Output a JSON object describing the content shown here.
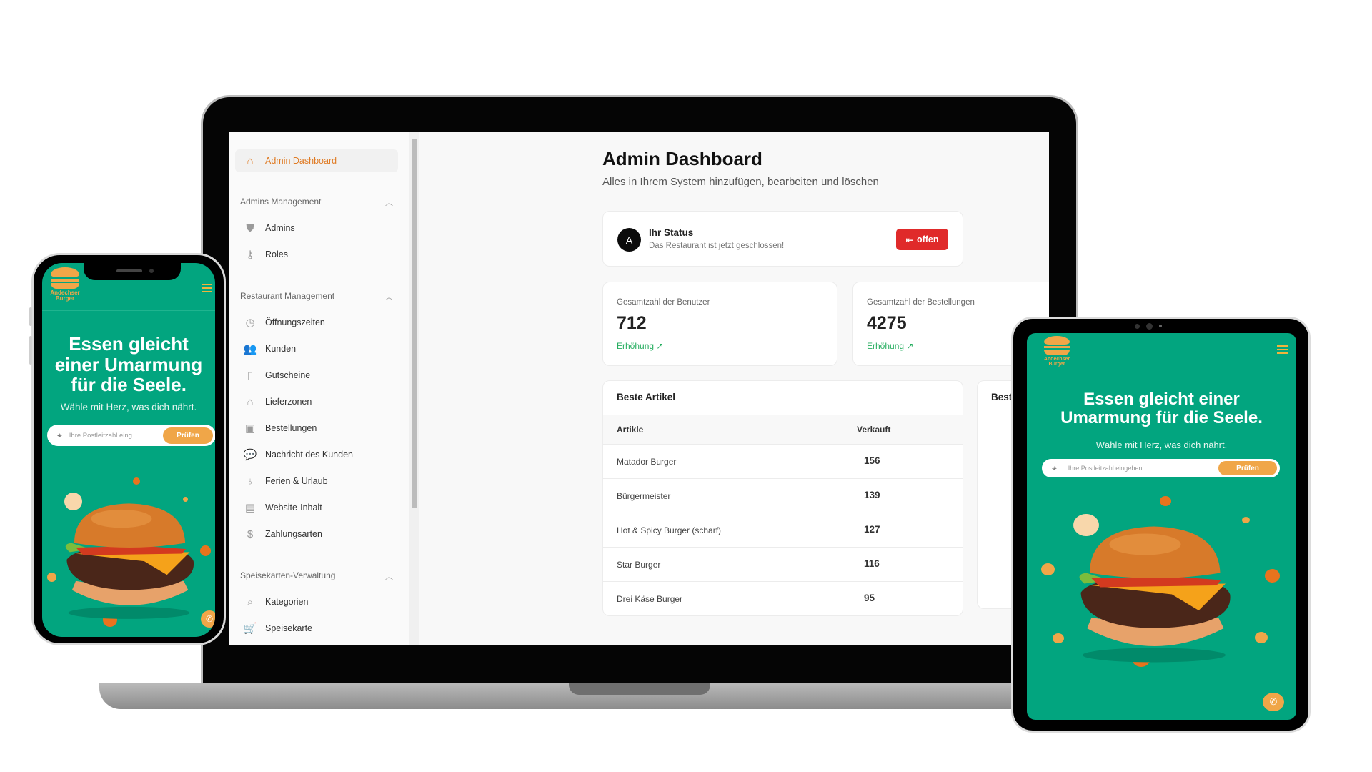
{
  "dashboard": {
    "sidebar": {
      "active_item": "Admin Dashboard",
      "groups": [
        {
          "label": "Admins Management",
          "items": [
            "Admins",
            "Roles"
          ]
        },
        {
          "label": "Restaurant Management",
          "items": [
            "Öffnungszeiten",
            "Kunden",
            "Gutscheine",
            "Lieferzonen",
            "Bestellungen",
            "Nachricht des Kunden",
            "Ferien & Urlaub",
            "Website-Inhalt",
            "Zahlungsarten"
          ]
        },
        {
          "label": "Speisekarten-Verwaltung",
          "items": [
            "Kategorien",
            "Speisekarte"
          ]
        }
      ]
    },
    "title": "Admin Dashboard",
    "subtitle": "Alles in Ihrem System hinzufügen, bearbeiten und löschen",
    "status": {
      "avatar": "A",
      "title": "Ihr Status",
      "text": "Das Restaurant ist jetzt geschlossen!",
      "button": "offen",
      "button_color": "#e02a2a"
    },
    "stats": [
      {
        "label": "Gesamtzahl der Benutzer",
        "value": "712",
        "trend": "Erhöhung"
      },
      {
        "label": "Gesamtzahl der Bestellungen",
        "value": "4275",
        "trend": "Erhöhung"
      }
    ],
    "best_items": {
      "title": "Beste Artikel",
      "columns": [
        "Artikle",
        "Verkauft"
      ],
      "rows": [
        [
          "Matador Burger",
          "156"
        ],
        [
          "Bürgermeister",
          "139"
        ],
        [
          "Hot & Spicy Burger (scharf)",
          "127"
        ],
        [
          "Star Burger",
          "116"
        ],
        [
          "Drei Käse Burger",
          "95"
        ]
      ]
    },
    "second_card_title": "Best"
  },
  "website": {
    "brand": "Andechser Burger",
    "headline": "Essen gleicht einer Umarmung für die Seele.",
    "subline": "Wähle mit Herz, was dich nährt.",
    "zip_placeholder": "Ihre Postleitzahl eingeben",
    "zip_placeholder_phone": "Ihre Postleitzahl eing",
    "check_button": "Prüfen",
    "brand_green": "#02a57f",
    "brand_orange": "#f0a648"
  }
}
